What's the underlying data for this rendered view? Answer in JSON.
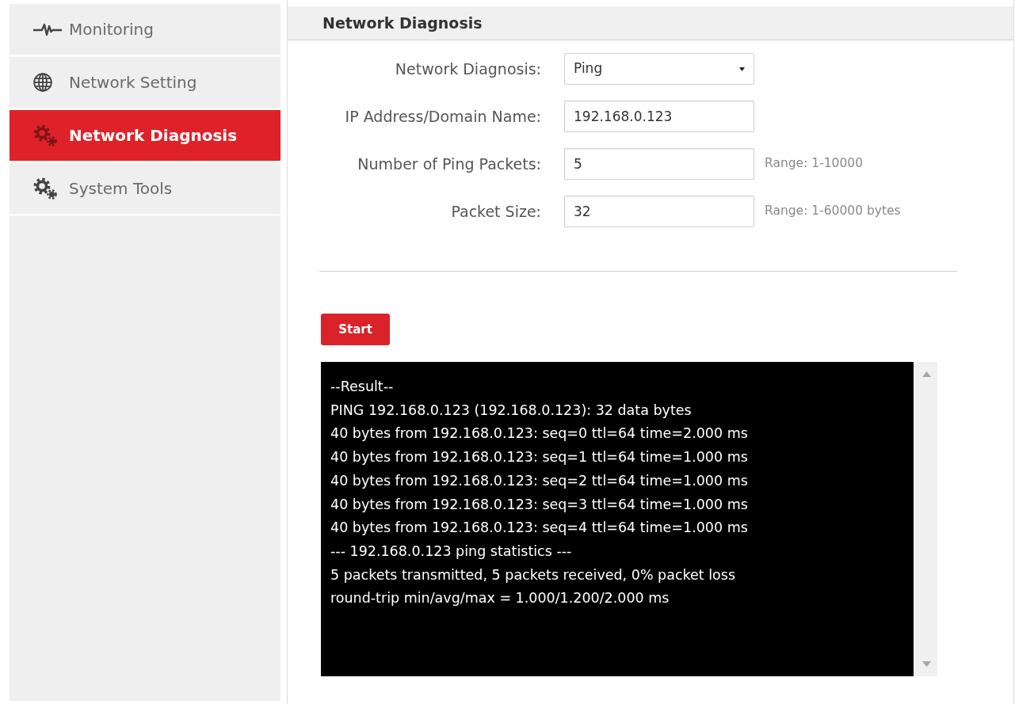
{
  "sidebar": {
    "items": [
      {
        "label": "Monitoring",
        "selected": false
      },
      {
        "label": "Network Setting",
        "selected": false
      },
      {
        "label": "Network Diagnosis",
        "selected": true
      },
      {
        "label": "System Tools",
        "selected": false
      }
    ]
  },
  "panel": {
    "title": "Network Diagnosis"
  },
  "form": {
    "fields": [
      {
        "kind": "select",
        "label": "Network Diagnosis:",
        "value": "Ping"
      },
      {
        "kind": "text",
        "label": "IP Address/Domain Name:",
        "value": "192.168.0.123"
      },
      {
        "kind": "text",
        "label": "Number of Ping Packets:",
        "value": "5",
        "hint": "Range: 1-10000"
      },
      {
        "kind": "text",
        "label": "Packet Size:",
        "value": "32",
        "hint": "Range: 1-60000 bytes"
      }
    ]
  },
  "start_button": {
    "label": "Start"
  },
  "result": {
    "lines": [
      "--Result--",
      "PING 192.168.0.123 (192.168.0.123): 32 data bytes",
      "40 bytes from 192.168.0.123: seq=0 ttl=64 time=2.000 ms",
      "40 bytes from 192.168.0.123: seq=1 ttl=64 time=1.000 ms",
      "40 bytes from 192.168.0.123: seq=2 ttl=64 time=1.000 ms",
      "40 bytes from 192.168.0.123: seq=3 ttl=64 time=1.000 ms",
      "40 bytes from 192.168.0.123: seq=4 ttl=64 time=1.000 ms",
      "--- 192.168.0.123 ping statistics ---",
      "5 packets transmitted, 5 packets received, 0% packet loss",
      "round-trip min/avg/max = 1.000/1.200/2.000 ms"
    ]
  }
}
